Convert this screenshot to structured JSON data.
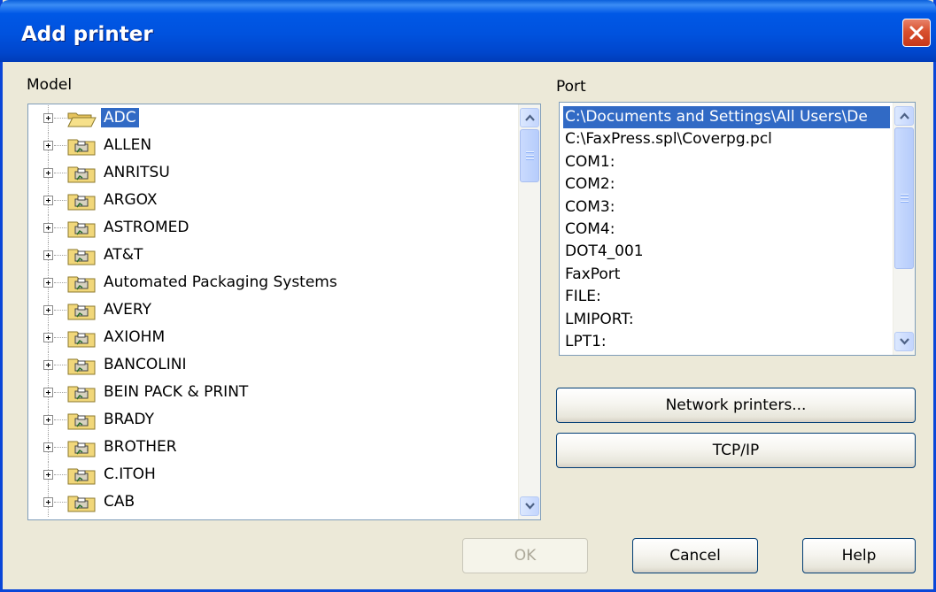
{
  "window": {
    "title": "Add printer"
  },
  "model": {
    "label": "Model",
    "items": [
      {
        "label": "ADC",
        "selected": true
      },
      {
        "label": "ALLEN"
      },
      {
        "label": "ANRITSU"
      },
      {
        "label": "ARGOX"
      },
      {
        "label": "ASTROMED"
      },
      {
        "label": "AT&T"
      },
      {
        "label": "Automated Packaging Systems"
      },
      {
        "label": "AVERY"
      },
      {
        "label": "AXIOHM"
      },
      {
        "label": "BANCOLINI"
      },
      {
        "label": "BEIN PACK & PRINT"
      },
      {
        "label": "BRADY"
      },
      {
        "label": "BROTHER"
      },
      {
        "label": "C.ITOH"
      },
      {
        "label": "CAB"
      }
    ]
  },
  "port": {
    "label": "Port",
    "items": [
      {
        "label": "C:\\Documents and Settings\\All Users\\De",
        "selected": true
      },
      {
        "label": "C:\\FaxPress.spl\\Coverpg.pcl"
      },
      {
        "label": "COM1:"
      },
      {
        "label": "COM2:"
      },
      {
        "label": "COM3:"
      },
      {
        "label": "COM4:"
      },
      {
        "label": "DOT4_001"
      },
      {
        "label": "FaxPort"
      },
      {
        "label": "FILE:"
      },
      {
        "label": "LMIPORT:"
      },
      {
        "label": "LPT1:"
      }
    ]
  },
  "buttons": {
    "network_printers": "Network printers...",
    "tcpip": "TCP/IP",
    "ok": "OK",
    "cancel": "Cancel",
    "help": "Help"
  },
  "colors": {
    "title_bar": "#0054E3",
    "selection": "#316AC5",
    "dialog_face": "#ECE9D8"
  }
}
